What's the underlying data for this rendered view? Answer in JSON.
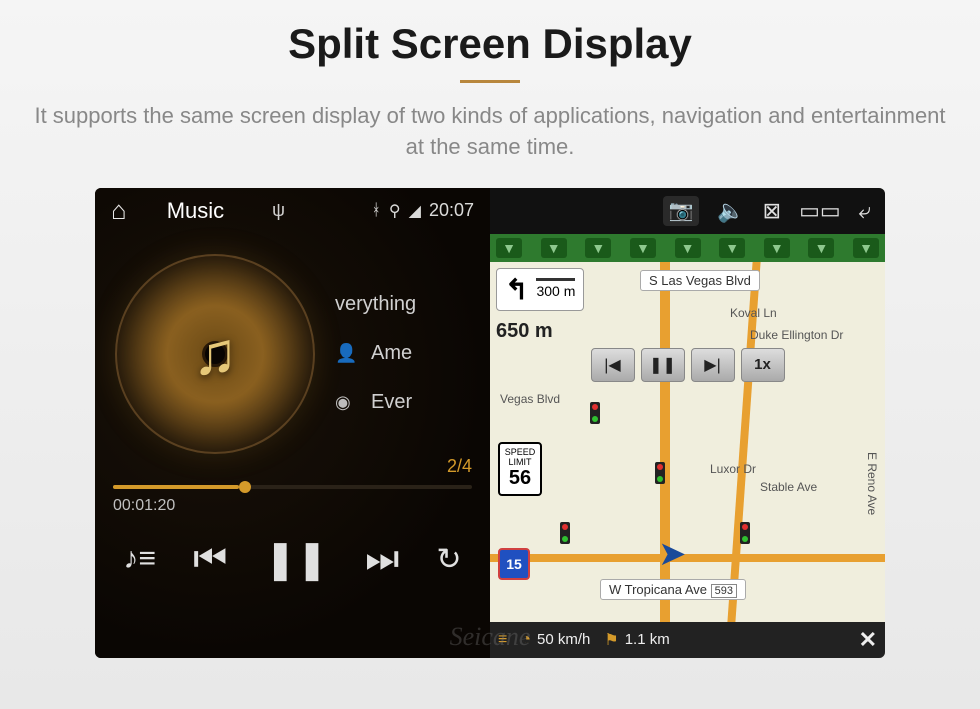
{
  "header": {
    "title": "Split Screen Display",
    "subtitle": "It supports the same screen display of two kinds of applications, navigation and entertainment at the same time."
  },
  "music": {
    "header_label": "Music",
    "clock": "20:07",
    "track_title": "verything",
    "artist": "Ame",
    "album": "Ever",
    "counter": "2/4",
    "elapsed": "00:01:20"
  },
  "nav": {
    "turn1_distance": "300 m",
    "turn2_distance": "650 m",
    "speed_limit_label": "SPEED LIMIT",
    "speed_limit_value": "56",
    "route_shield": "15",
    "playback_speed": "1x",
    "streets": {
      "main_top": "S Las Vegas Blvd",
      "main_bottom": "W Tropicana Ave",
      "bottom_exit": "593",
      "koval": "Koval Ln",
      "duke": "Duke Ellington Dr",
      "vegas_blvd": "Vegas Blvd",
      "luxor": "Luxor Dr",
      "stable": "Stable Ave",
      "reno": "E Reno Ave"
    },
    "bottom": {
      "current_speed": "50 km/h",
      "remaining_dist": "1.1 km"
    }
  },
  "watermark": "Seicane"
}
